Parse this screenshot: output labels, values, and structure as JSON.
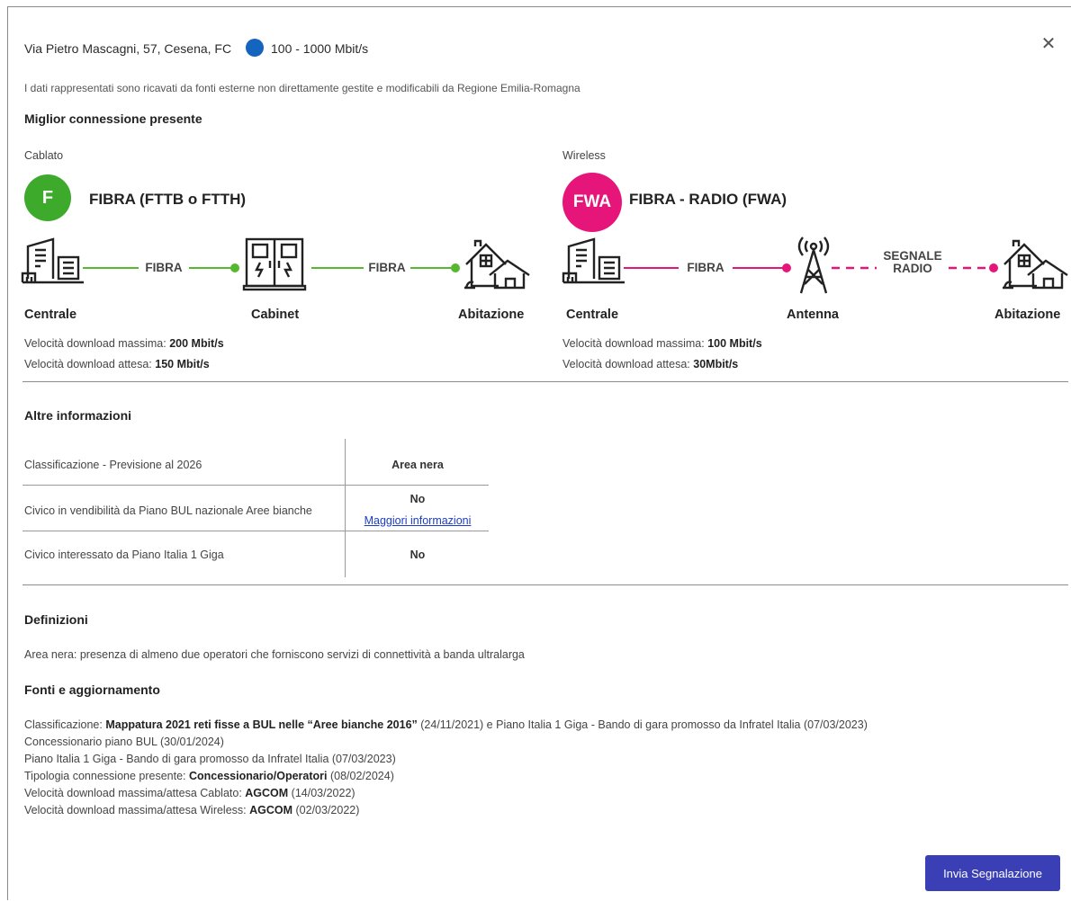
{
  "header": {
    "address": "Via Pietro Mascagni, 57, Cesena, FC",
    "speed_range": "100 - 1000 Mbit/s",
    "speed_dot_color": "#1565c0",
    "close_icon": "close-icon"
  },
  "disclaimer": "I dati rappresentati sono ricavati da fonti esterne non direttamente gestite e modificabili da Regione Emilia-Romagna",
  "best_connection": {
    "title": "Miglior connessione presente",
    "wired": {
      "category": "Cablato",
      "badge": "F",
      "badge_color": "#3eaa2c",
      "title": "FIBRA (FTTB o FTTH)",
      "line_label_1": "FIBRA",
      "line_label_2": "FIBRA",
      "line_color": "#56b82e",
      "nodes": [
        "Centrale",
        "Cabinet",
        "Abitazione"
      ],
      "max_label": "Velocità download massima: ",
      "max_value": "200 Mbit/s",
      "expected_label": "Velocità download attesa: ",
      "expected_value": "150 Mbit/s"
    },
    "wireless": {
      "category": "Wireless",
      "badge": "FWA",
      "badge_color": "#e6157a",
      "title": "FIBRA - RADIO (FWA)",
      "line_label_1": "FIBRA",
      "line_label_2a": "SEGNALE",
      "line_label_2b": "RADIO",
      "line_color": "#e6157a",
      "nodes": [
        "Centrale",
        "Antenna",
        "Abitazione"
      ],
      "max_label": "Velocità download massima: ",
      "max_value": "100 Mbit/s",
      "expected_label": "Velocità download attesa: ",
      "expected_value": "30Mbit/s"
    }
  },
  "other_info": {
    "title": "Altre informazioni",
    "rows": [
      {
        "label": "Classificazione - Previsione al 2026",
        "value": "Area nera"
      },
      {
        "label": "Civico in vendibilità da Piano BUL nazionale Aree bianche",
        "value": "No",
        "link": "Maggiori informazioni"
      },
      {
        "label": "Civico interessato da Piano Italia 1 Giga",
        "value": "No"
      }
    ]
  },
  "definitions": {
    "title": "Definizioni",
    "text": "Area nera: presenza di almeno due operatori che forniscono servizi di connettività a banda ultralarga"
  },
  "sources": {
    "title": "Fonti e aggiornamento",
    "line1_pre": "Classificazione: ",
    "line1_bold": "Mappatura 2021 reti fisse a BUL nelle “Aree bianche 2016”",
    "line1_post": " (24/11/2021) e Piano Italia 1 Giga - Bando di gara promosso da Infratel Italia (07/03/2023)",
    "line2": "Concessionario piano BUL (30/01/2024)",
    "line3": "Piano Italia 1 Giga - Bando di gara promosso da Infratel Italia (07/03/2023)",
    "line4_pre": "Tipologia connessione presente: ",
    "line4_bold": "Concessionario/Operatori",
    "line4_post": " (08/02/2024)",
    "line5_pre": "Velocità download massima/attesa Cablato: ",
    "line5_bold": "AGCOM",
    "line5_post": " (14/03/2022)",
    "line6_pre": "Velocità download massima/attesa Wireless: ",
    "line6_bold": "AGCOM",
    "line6_post": " (02/03/2022)"
  },
  "submit_button": "Invia Segnalazione"
}
